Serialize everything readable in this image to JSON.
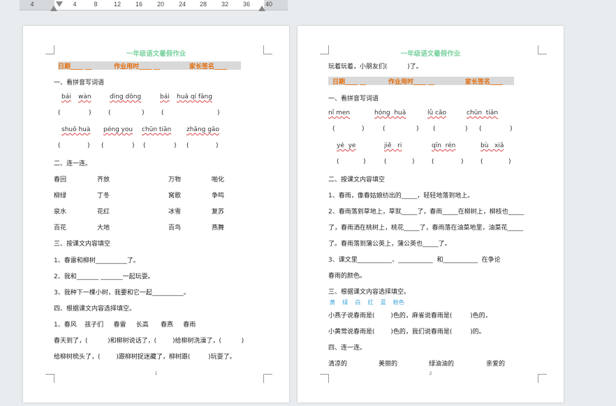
{
  "ruler": {
    "ticks": [
      "4",
      "4",
      "8",
      "12",
      "16",
      "20",
      "24",
      "28",
      "32",
      "36",
      "40"
    ]
  },
  "header": {
    "title": "一年级语文暑假作业",
    "date_label": "日期____ __",
    "time_label": "作业用时____ __",
    "sign_label": "家长签名____"
  },
  "page1": {
    "s1": "一、看拼音写词语",
    "py1": [
      "bái",
      "wàn",
      "dìng dōng",
      "bái",
      "huā qí fāng"
    ],
    "br1": [
      "(",
      ")",
      "(",
      ")",
      "(",
      ")"
    ],
    "py2": [
      "shuō huà",
      "péng you",
      "chūn tiān",
      "zhǎng gāo"
    ],
    "br2": [
      "(",
      ")",
      "(",
      ")",
      "(",
      ")",
      "(",
      ")"
    ],
    "s2": "二、连一连。",
    "match": [
      [
        "春回",
        "齐放",
        "万物",
        "啪化"
      ],
      [
        "柳绿",
        "丁冬",
        "窝歌",
        "争鸣"
      ],
      [
        "泉水",
        "花红",
        "冰雪",
        "复苏"
      ],
      [
        "百花",
        "大地",
        "百鸟",
        "燕舞"
      ]
    ],
    "s3": "三、按课文内容填空",
    "f1": "1、春雷和柳树__________了。",
    "f2": "2、我和_______ _______一起玩耍。",
    "f3": "3、我种下一棵小树，我要和它一起__________。",
    "s4": "四、根据课文内容选择填空。",
    "words": "1、春风    孩子们     春雷     长高      春燕     春雨",
    "q1": "春天到了，(          )和柳树说话了，(        )给柳树洗澡了，(          )",
    "q2": "给柳树梳头了，(        )跟柳树捉迷藏了，柳树跟(         )玩耍了。",
    "num": "1"
  },
  "page2": {
    "top": "玩着玩着，小朋友们(          )了。",
    "s1": "一、看拼音写词语",
    "py1": [
      "nǐ men",
      "hóng  huā",
      "lǜ cǎo",
      "chūn  tiān"
    ],
    "br1": [
      "(",
      ")",
      "(",
      ")",
      "(",
      ")",
      "(",
      ")"
    ],
    "py2": [
      "yé  ye",
      "jiě   ri",
      "qīn  rén",
      "bù   xiǎ"
    ],
    "br2": [
      "(",
      ")",
      "(",
      ")",
      "(",
      ")",
      "(",
      ")"
    ],
    "s2": "二、按课文内容填空",
    "f1": "1、春雨，像春姑娘纺出的_____，轻轻地落到地上。",
    "f2": "2、春雨落到草地上，草就_____了，春雨_____在柳树上，柳枝也_____",
    "f3": "了，春雨洒在桃树上，桃花_____了，春雨落在油菜地里，油菜花_____",
    "f4": "了。春雨落到蒲公英上，蒲公英也_____了。",
    "f5": "3、课文里___________、___________  和___________  在争论",
    "f6": "春雨的颜色。",
    "s3": "三、根据课文内容选择填空。",
    "colors": "黄    绿    白    红    蓝    粉色",
    "q1": "小燕子说春雨是(        )色的，麻雀说春雨是(         )色的，",
    "q2": "小黄莺说春雨是(        )色的，我们说春雨是(         )的。",
    "s4": "四、连一连。",
    "adj": [
      "清凉的",
      "美丽的",
      "绿油油的",
      "亲爱的"
    ],
    "num": "2"
  }
}
